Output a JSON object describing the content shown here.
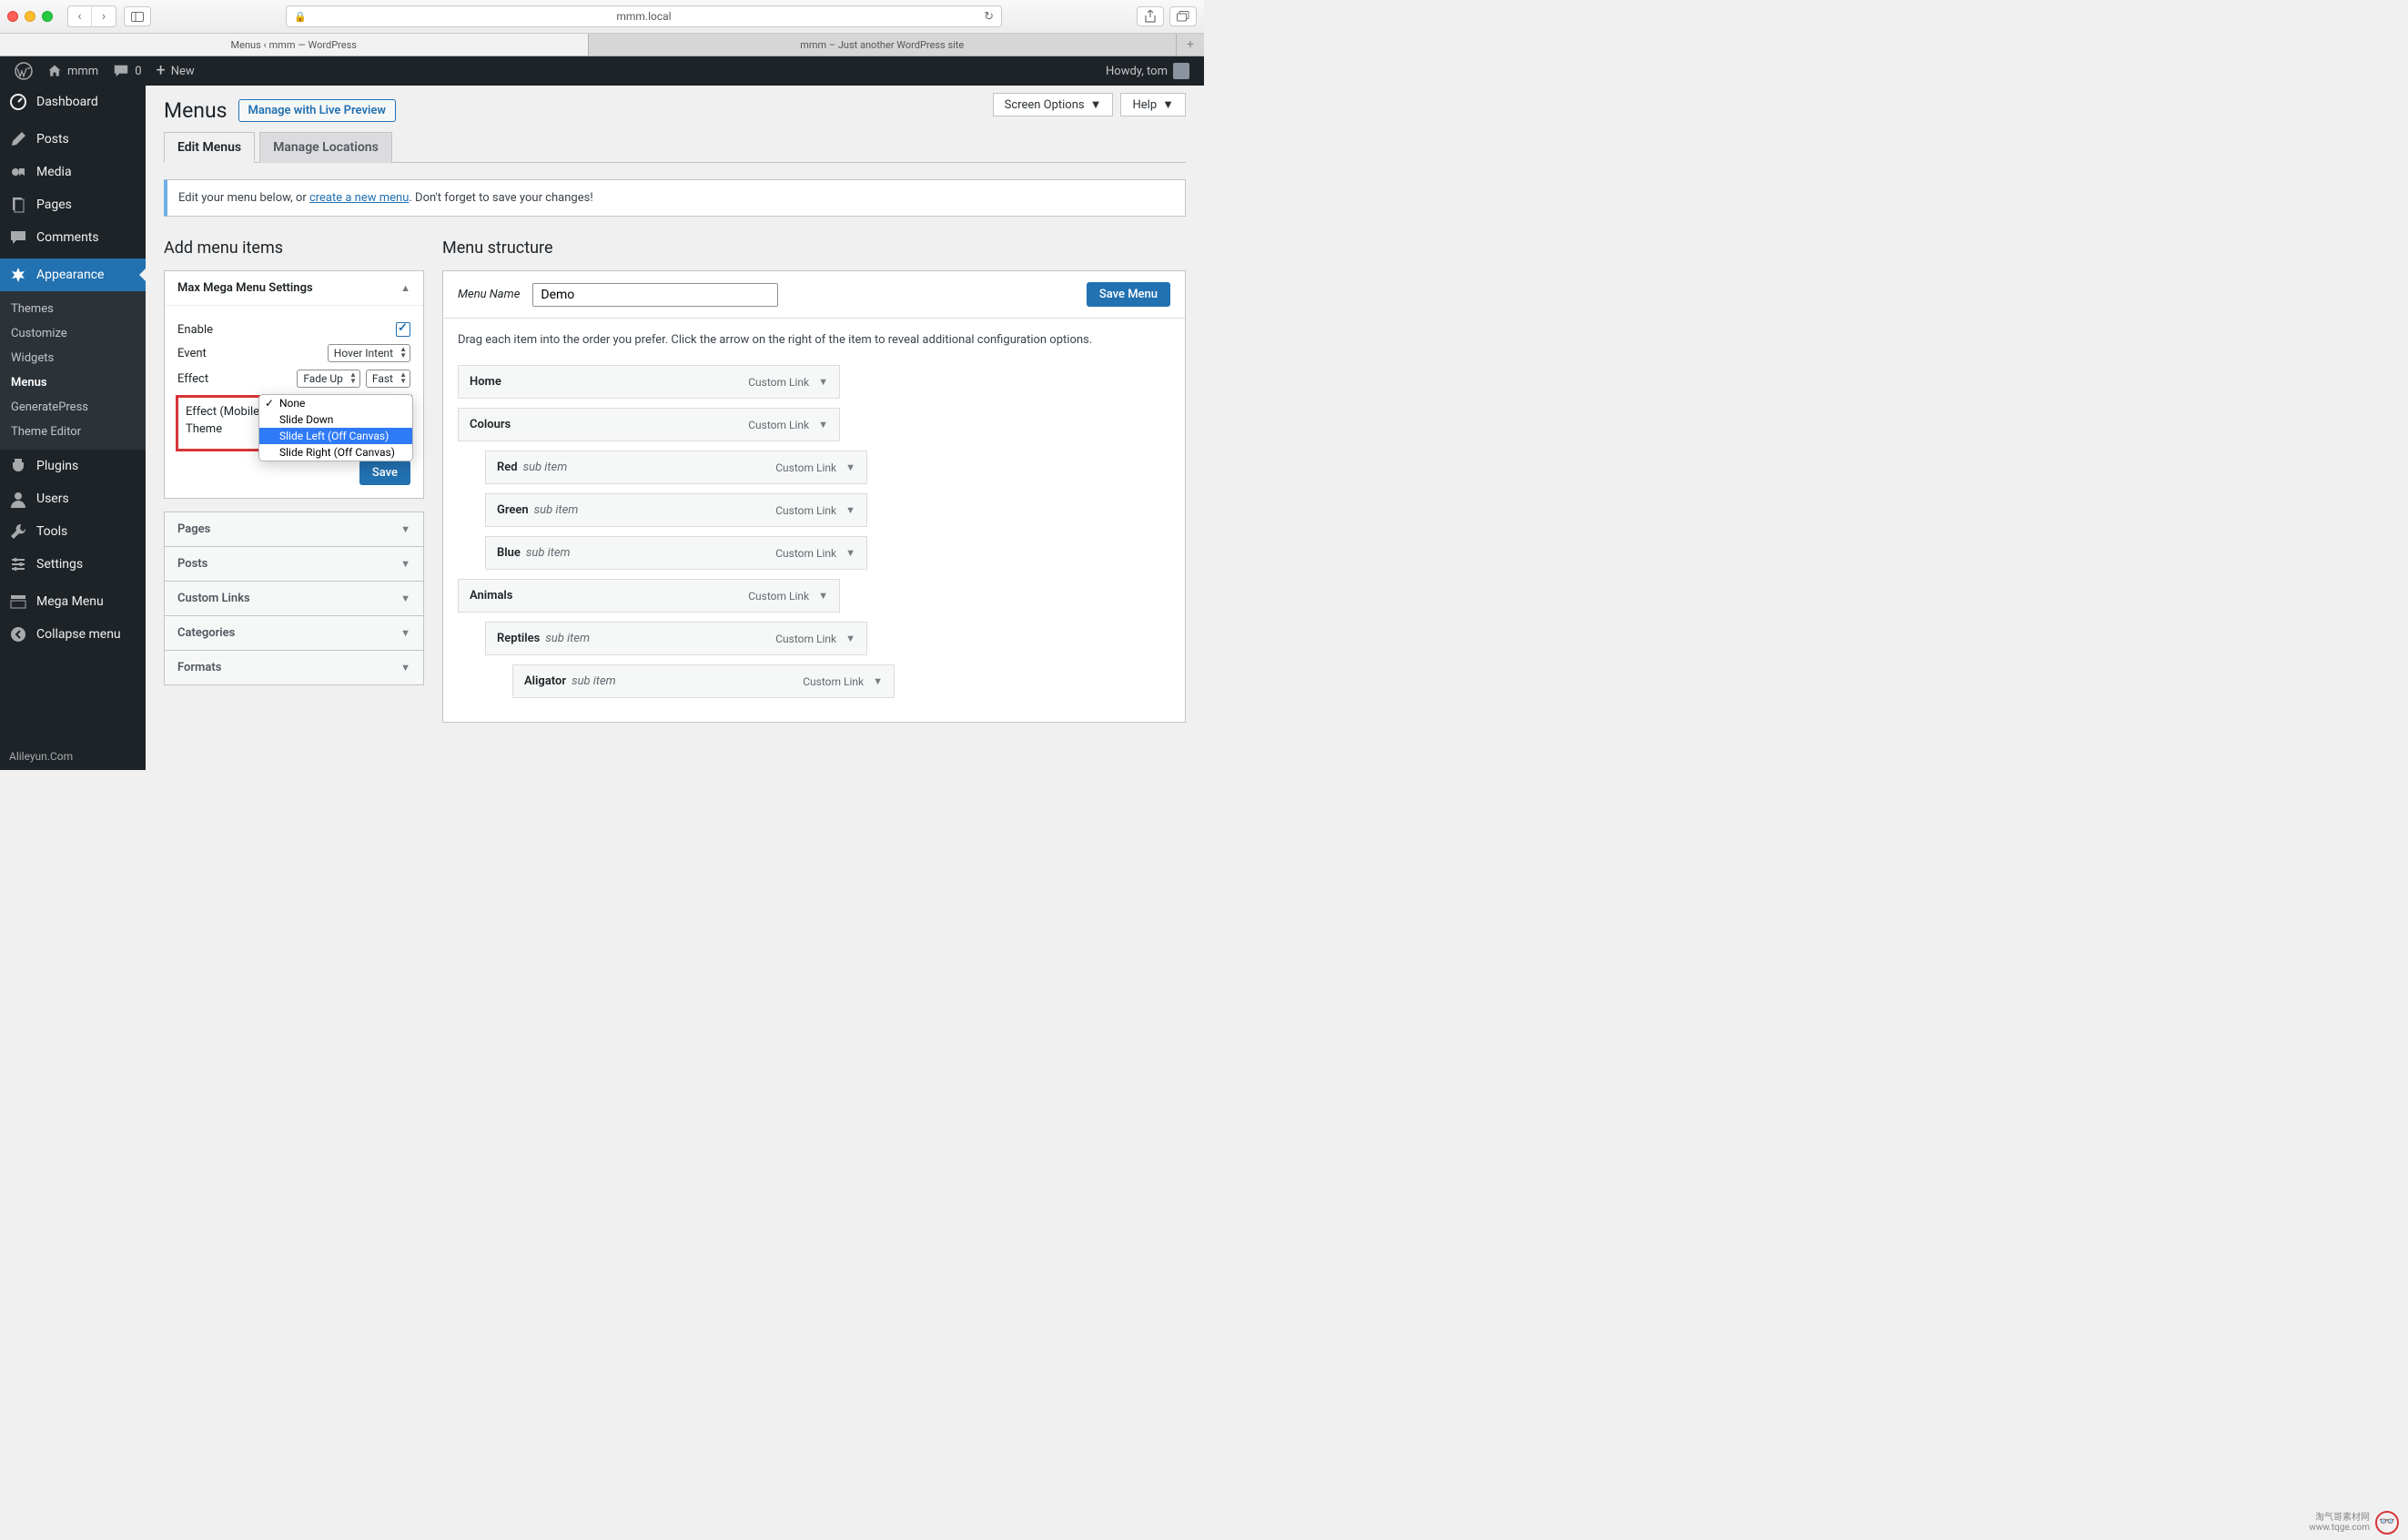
{
  "safari": {
    "url": "mmm.local",
    "tabs": [
      "Menus ‹ mmm — WordPress",
      "mmm – Just another WordPress site"
    ]
  },
  "adminbar": {
    "site": "mmm",
    "comments": "0",
    "new": "New",
    "howdy": "Howdy, tom"
  },
  "sidebar": {
    "dashboard": "Dashboard",
    "posts": "Posts",
    "media": "Media",
    "pages": "Pages",
    "comments": "Comments",
    "appearance": "Appearance",
    "sub": {
      "themes": "Themes",
      "customize": "Customize",
      "widgets": "Widgets",
      "menus": "Menus",
      "generatepress": "GeneratePress",
      "theme_editor": "Theme Editor"
    },
    "plugins": "Plugins",
    "users": "Users",
    "tools": "Tools",
    "settings": "Settings",
    "mega": "Mega Menu",
    "collapse": "Collapse menu",
    "footer": "Alileyun.Com"
  },
  "top": {
    "screen_options": "Screen Options",
    "help": "Help"
  },
  "heading": {
    "title": "Menus",
    "live_preview": "Manage with Live Preview"
  },
  "tabs": {
    "edit": "Edit Menus",
    "locations": "Manage Locations"
  },
  "notice": {
    "prefix": "Edit your menu below, or ",
    "link": "create a new menu",
    "suffix": ". Don't forget to save your changes!"
  },
  "left": {
    "heading": "Add menu items",
    "mega_settings": "Max Mega Menu Settings",
    "enable": "Enable",
    "event": "Event",
    "event_val": "Hover Intent",
    "effect": "Effect",
    "effect_val": "Fade Up",
    "effect_speed": "Fast",
    "effect_mobile": "Effect (Mobile)",
    "theme": "Theme",
    "dropdown": {
      "none": "None",
      "slide_down": "Slide Down",
      "slide_left": "Slide Left (Off Canvas)",
      "slide_right": "Slide Right (Off Canvas)"
    },
    "save": "Save",
    "panels": {
      "pages": "Pages",
      "posts": "Posts",
      "custom": "Custom Links",
      "categories": "Categories",
      "formats": "Formats"
    }
  },
  "right": {
    "heading": "Menu structure",
    "menu_name_label": "Menu Name",
    "menu_name_value": "Demo",
    "save_menu": "Save Menu",
    "instructions": "Drag each item into the order you prefer. Click the arrow on the right of the item to reveal additional configuration options.",
    "type_custom": "Custom Link",
    "sub_item": "sub item",
    "items": [
      {
        "title": "Home",
        "type": "Custom Link",
        "level": 0
      },
      {
        "title": "Colours",
        "type": "Custom Link",
        "level": 0
      },
      {
        "title": "Red",
        "sub": true,
        "type": "Custom Link",
        "level": 1
      },
      {
        "title": "Green",
        "sub": true,
        "type": "Custom Link",
        "level": 1
      },
      {
        "title": "Blue",
        "sub": true,
        "type": "Custom Link",
        "level": 1
      },
      {
        "title": "Animals",
        "type": "Custom Link",
        "level": 0
      },
      {
        "title": "Reptiles",
        "sub": true,
        "type": "Custom Link",
        "level": 1
      },
      {
        "title": "Aligator",
        "sub": true,
        "type": "Custom Link",
        "level": 2
      }
    ]
  },
  "watermark": {
    "line1": "淘气哥素材网",
    "line2": "www.tqge.com"
  }
}
